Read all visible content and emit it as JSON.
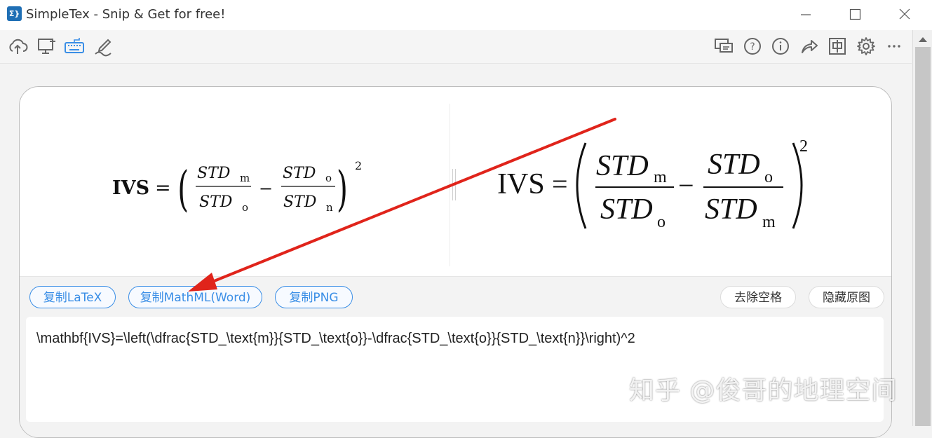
{
  "window": {
    "title": "SimpleTex - Snip & Get for free!",
    "app_icon_text": "Σ}"
  },
  "toolbar": {
    "left_icons": [
      "cloud-upload-icon",
      "screen-capture-icon",
      "keyboard-icon",
      "handwriting-icon"
    ],
    "right_icons": [
      "feedback-icon",
      "help-icon",
      "info-icon",
      "share-icon",
      "chinese-mode-icon",
      "settings-icon",
      "more-icon"
    ]
  },
  "formulas": {
    "rendered": {
      "lhs": "IVS",
      "num1": "STD",
      "num1_sub": "m",
      "den1": "STD",
      "den1_sub": "o",
      "num2": "STD",
      "num2_sub": "o",
      "den2": "STD",
      "den2_sub": "n",
      "exponent": "2"
    },
    "original": {
      "lhs": "IVS",
      "num1": "STD",
      "num1_sub": "m",
      "den1": "STD",
      "den1_sub": "o",
      "num2": "STD",
      "num2_sub": "o",
      "den2": "STD",
      "den2_sub": "m",
      "exponent": "2"
    }
  },
  "buttons": {
    "copy_latex": "复制LaTeX",
    "copy_mathml": "复制MathML(Word)",
    "copy_png": "复制PNG",
    "remove_spaces": "去除空格",
    "hide_original": "隐藏原图"
  },
  "latex_output": "\\mathbf{IVS}=\\left(\\dfrac{STD_\\text{m}}{STD_\\text{o}}-\\dfrac{STD_\\text{o}}{STD_\\text{n}}\\right)^2",
  "watermark": "知乎 @俊哥的地理空间",
  "colors": {
    "accent": "#3a8ee6",
    "arrow": "#e0241b",
    "toolbar_active": "#3a8ee6"
  }
}
